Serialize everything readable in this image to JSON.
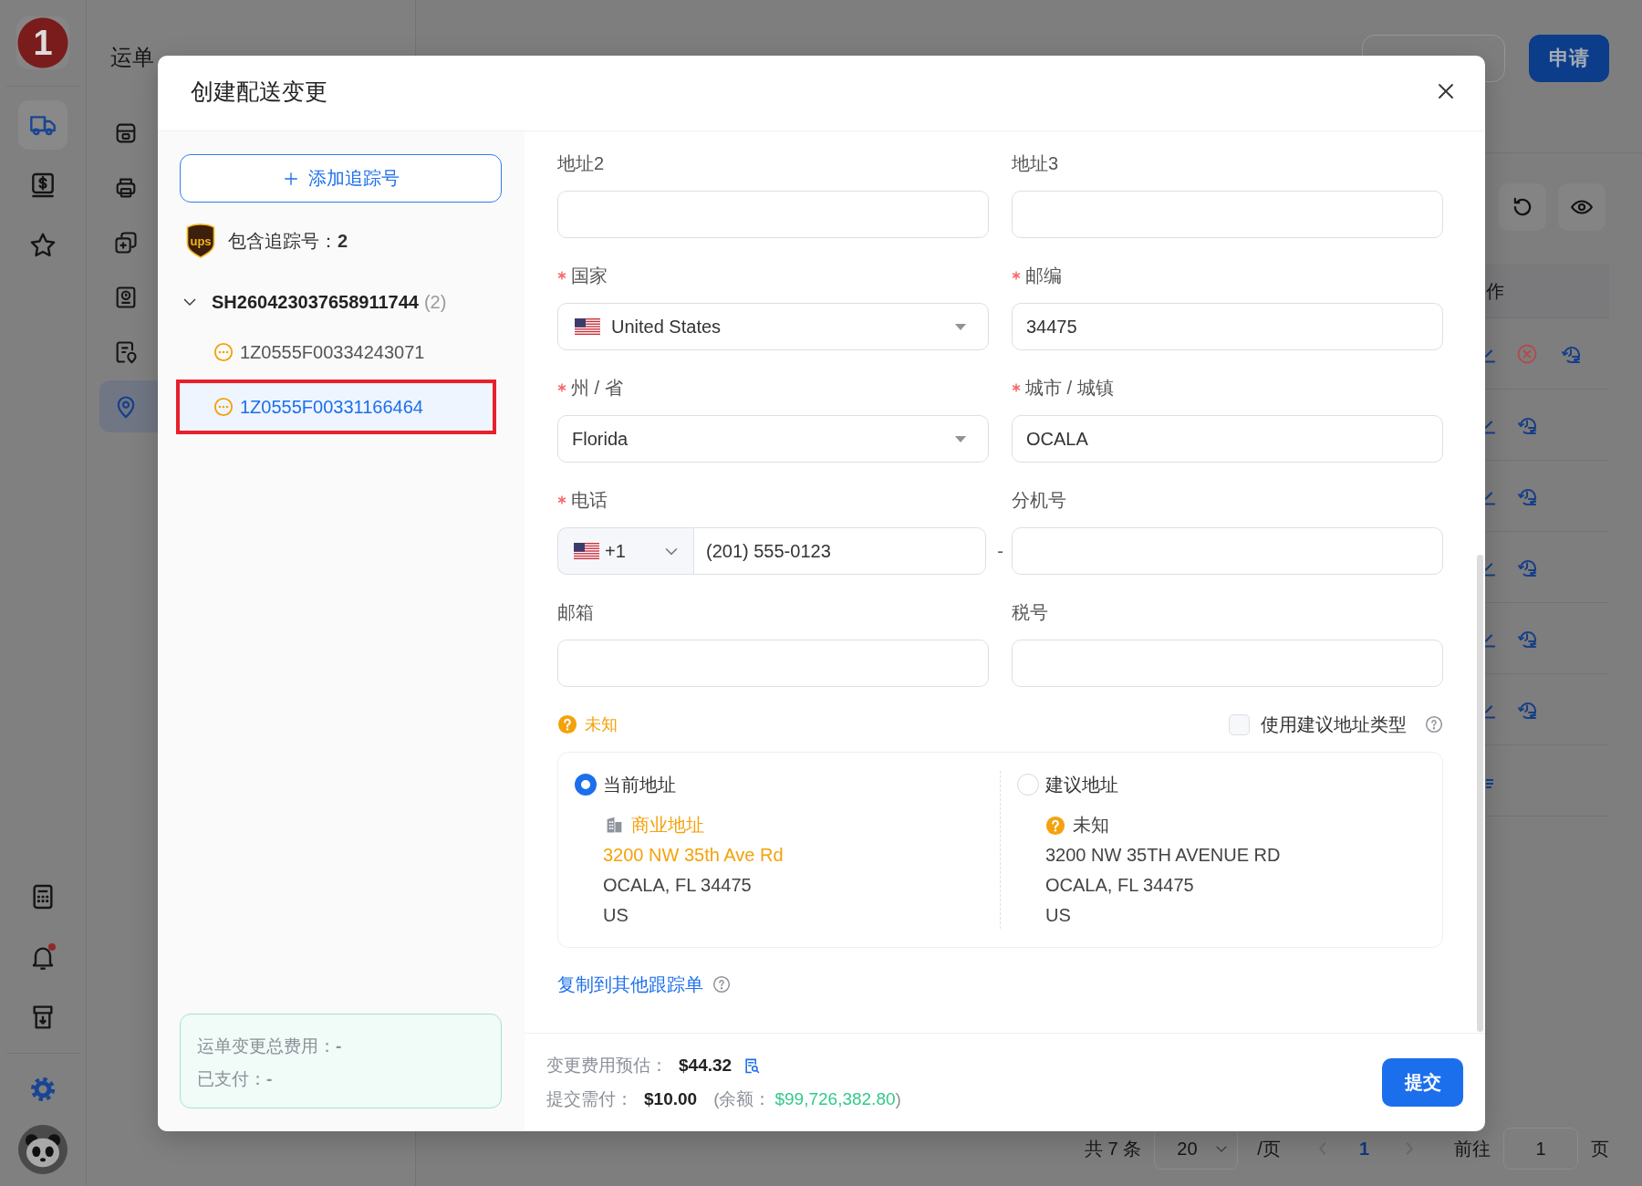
{
  "rail": {
    "logo": "1",
    "items": [
      {
        "selected": true
      },
      {
        "selected": false
      },
      {
        "selected": false
      }
    ],
    "bottom_items": [
      {
        "notification": false
      },
      {
        "notification": true
      },
      {
        "notification": false
      }
    ]
  },
  "sidebar": {
    "title": "运单",
    "items": [
      {
        "selected": false
      },
      {
        "selected": false
      },
      {
        "selected": false
      },
      {
        "selected": false
      },
      {
        "selected": false
      },
      {
        "selected": true
      }
    ]
  },
  "header": {
    "actions": [
      {
        "kind": "outline"
      },
      {
        "kind": "primary",
        "label": "申请"
      }
    ]
  },
  "table": {
    "columns": [
      {
        "label": "作"
      }
    ],
    "rows": [
      {
        "editable": true,
        "cancellable": true
      },
      {
        "editable": true,
        "cancellable": false
      },
      {
        "editable": true,
        "cancellable": false
      },
      {
        "editable": true,
        "cancellable": false
      },
      {
        "editable": true,
        "cancellable": false
      },
      {
        "editable": true,
        "cancellable": false
      },
      {
        "editable": false,
        "cancellable": false
      }
    ]
  },
  "pagination": {
    "total": "共 7 条",
    "page_size": "20",
    "page_size_unit": "/页",
    "pages": [
      {
        "label": "1",
        "selected": true
      }
    ],
    "goto_label": "前往",
    "goto_value": "1",
    "goto_unit": "页"
  },
  "dialog": {
    "title": "创建配送变更",
    "add_button": "添加追踪号",
    "carrier": {
      "logo": "ups",
      "summary": "包含追踪号：**2**"
    },
    "shipments": [
      {
        "number": "SH260423037658911744",
        "count": "(2)",
        "expanded": true,
        "children": [
          {
            "number": "1Z0555F00334243071",
            "selected": false,
            "annotated": false
          },
          {
            "number": "1Z0555F00331166464",
            "selected": true,
            "annotated": true
          }
        ]
      }
    ],
    "fee_summary": [
      "运单变更总费用：**-**",
      "已支付：**-**"
    ],
    "fields": [
      {
        "kind": "text",
        "label": "地址2",
        "required": false
      },
      {
        "kind": "text",
        "label": "地址3",
        "required": false
      },
      {
        "kind": "country",
        "label": "国家",
        "required": true,
        "value": "United States"
      },
      {
        "kind": "text",
        "label": "邮编",
        "required": true,
        "value": "34475"
      },
      {
        "kind": "select",
        "label": "州 / 省",
        "required": true,
        "value": "Florida"
      },
      {
        "kind": "text",
        "label": "城市 / 城镇",
        "required": true,
        "value": "OCALA"
      },
      {
        "kind": "phone",
        "label": "电话",
        "required": true,
        "code": "+1",
        "value": "(201) 555-0123",
        "separator": "-"
      },
      {
        "kind": "text",
        "label": "分机号",
        "required": false
      },
      {
        "kind": "text",
        "label": "邮箱",
        "required": false
      },
      {
        "kind": "text",
        "label": "税号",
        "required": false
      }
    ],
    "address_status": {
      "kind": "unknown",
      "label": "未知"
    },
    "suggest_type": {
      "label": "使用建议地址类型",
      "checked": false
    },
    "address_options": [
      {
        "title": "当前地址",
        "selected": true,
        "type": {
          "kind": "business",
          "label": "商业地址",
          "highlighted": true
        },
        "lines": [
          {
            "text": "3200 NW 35th Ave Rd",
            "highlighted": true
          },
          {
            "text": "OCALA, FL 34475",
            "highlighted": false
          },
          {
            "text": "US",
            "highlighted": false
          }
        ]
      },
      {
        "title": "建议地址",
        "selected": false,
        "type": {
          "kind": "unknown",
          "label": "未知",
          "highlighted": false
        },
        "lines": [
          {
            "text": "3200 NW 35TH AVENUE RD",
            "highlighted": false
          },
          {
            "text": "OCALA, FL 34475",
            "highlighted": false
          },
          {
            "text": "US",
            "highlighted": false
          }
        ]
      }
    ],
    "copy_link": "复制到其他跟踪单",
    "estimate": {
      "label": "变更费用预估：",
      "value": "$44.32"
    },
    "due": {
      "label": "提交需付：",
      "value": "$10.00",
      "balance_label": "(余额：",
      "balance": "$99,726,382.80",
      "balance_end": ")"
    },
    "submit": "提交"
  }
}
